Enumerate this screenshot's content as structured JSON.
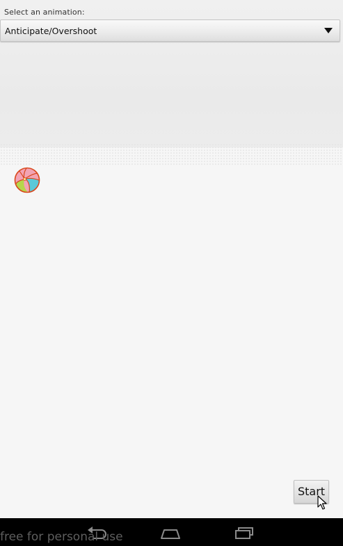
{
  "header": {
    "select_label": "Select an animation:"
  },
  "animation_spinner": {
    "selected_value": "Anticipate/Overshoot"
  },
  "actions": {
    "start_label": "Start"
  },
  "navigation_bar": {
    "back_icon": "back-arrow-icon",
    "home_icon": "home-icon",
    "recents_icon": "recent-apps-icon"
  },
  "watermark": {
    "text": "free for personal use"
  },
  "colors": {
    "background": "#f6f6f6",
    "navbar": "#000000",
    "ball_pink": "#f2a4b4",
    "ball_cyan": "#5bc8d8",
    "ball_green": "#b6d64a",
    "ball_outline": "#d9481c"
  }
}
